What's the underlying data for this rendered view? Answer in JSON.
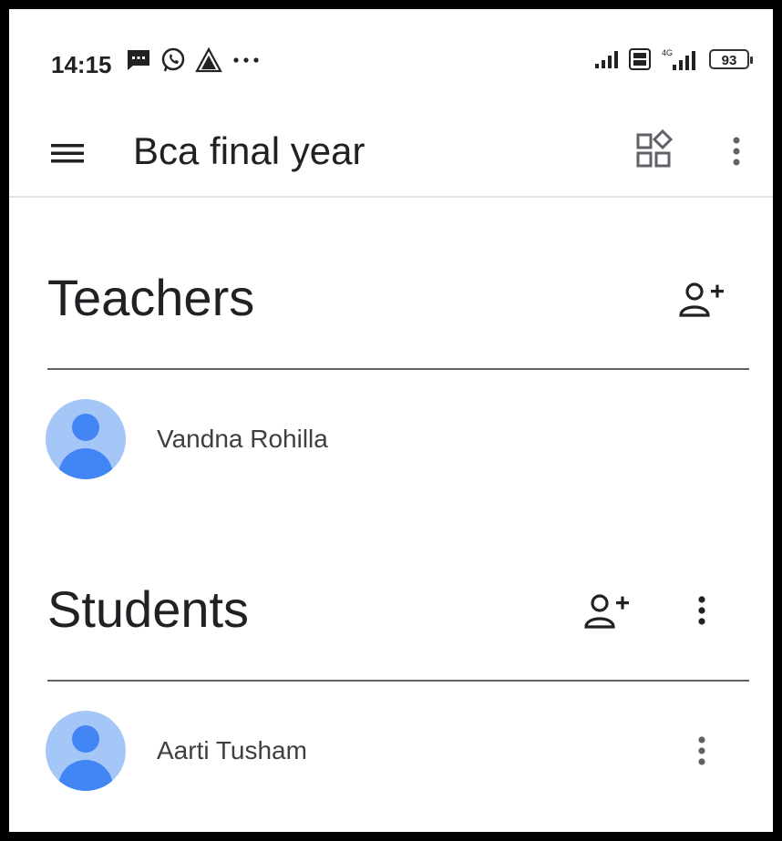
{
  "status_bar": {
    "time": "14:15",
    "battery": "93",
    "network": "4G"
  },
  "app_bar": {
    "title": "Bca final year"
  },
  "teachers": {
    "heading": "Teachers",
    "people": [
      {
        "name": "Vandna Rohilla"
      }
    ]
  },
  "students": {
    "heading": "Students",
    "people": [
      {
        "name": "Aarti Tusham"
      }
    ]
  },
  "colors": {
    "avatar_bg": "#a5c7f7",
    "avatar_fg": "#4285f4",
    "text": "#202124",
    "divider": "#5f6368"
  }
}
